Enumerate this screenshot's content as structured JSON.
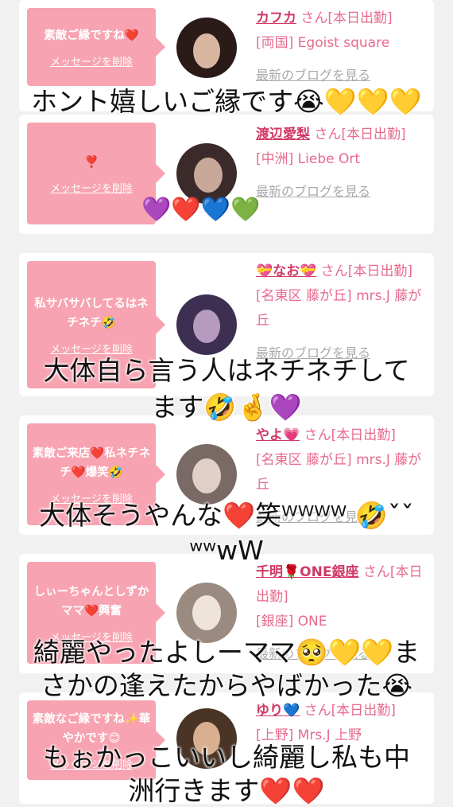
{
  "delete_label": "メッセージを削除",
  "blog_label": "最新のブログを見る",
  "cards": [
    {
      "message": "素敵ご縁ですね❤️",
      "name": "カフカ",
      "suffix": " さん[本日出勤]",
      "shop": "[両国] Egoist square",
      "avatar_colors": [
        "#2a1a18",
        "#d9b6a0"
      ]
    },
    {
      "message": "❣️",
      "name": "渡辺愛梨",
      "suffix": " さん[本日出勤]",
      "shop": "[中洲] Liebe Ort",
      "avatar_colors": [
        "#3b2a2a",
        "#c8a898"
      ]
    },
    {
      "message": "私サバサバしてるはネチネチ🤣",
      "name": "💝なお💝",
      "suffix": " さん[本日出勤]",
      "shop": "[名東区 藤が丘] mrs.J 藤が丘",
      "avatar_colors": [
        "#3d2f52",
        "#b79bbf"
      ]
    },
    {
      "message": "素敵ご来店❤️私ネチネチ❤️爆笑🤣",
      "name": "やよ💗",
      "suffix": " さん[本日出勤]",
      "shop": "[名東区 藤が丘] mrs.J 藤が丘",
      "avatar_colors": [
        "#7a6a66",
        "#e0d0c8"
      ]
    },
    {
      "message": "しぃーちゃんとしずかママ❤️興奮",
      "name": "千明🌹ONE銀座",
      "suffix": " さん[本日出勤]",
      "shop": "[銀座] ONE",
      "avatar_colors": [
        "#9a8a80",
        "#efe4da"
      ]
    },
    {
      "message": "素敵なご縁ですね✨華やかです😊",
      "name": "ゆり💙",
      "suffix": " さん[本日出勤]",
      "shop": "[上野] Mrs.J 上野",
      "avatar_colors": [
        "#4a3426",
        "#d8b090"
      ]
    }
  ],
  "captions": [
    "ホント嬉しいご縁です😭💛💛💛",
    "💜❤️💙💚",
    "大体自ら言う人はネチネチして",
    "ます🤣🤞💜",
    "大体そうやんな❤️笑ᵂᵂᵂᵂ 🤣ˇˇ",
    "ʷʷwW",
    "綺麗やったよしーママ🥺💛💛ま",
    "さかの逢えたからやばかった😭",
    "もぉかっこいいし綺麗し私も中",
    "洲行きます❤️❤️"
  ]
}
